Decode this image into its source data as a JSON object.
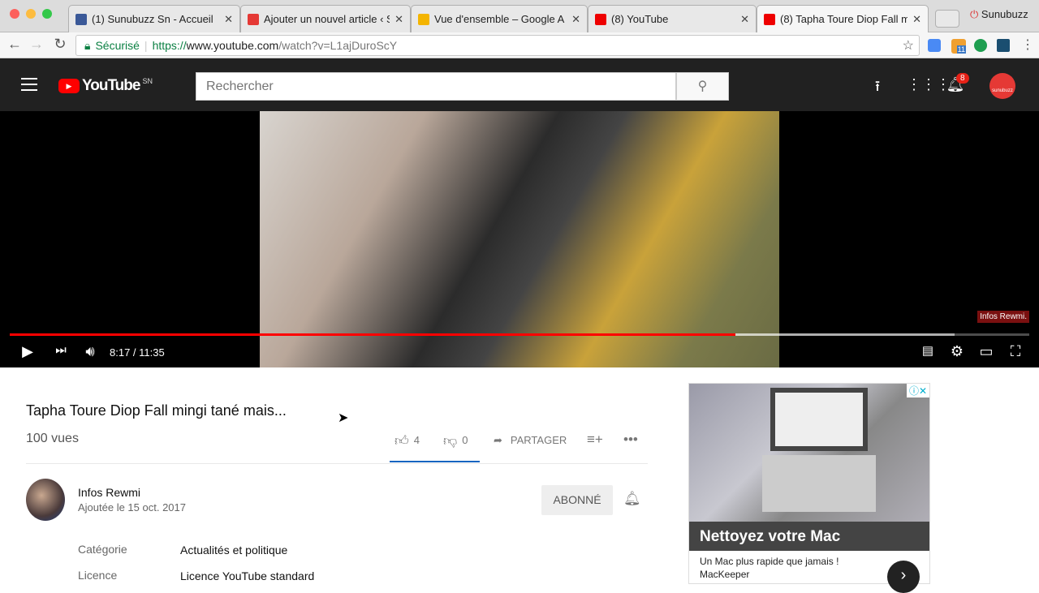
{
  "browser": {
    "tabs": [
      {
        "title": "(1) Sunubuzz Sn - Accueil",
        "favicon": "facebook-icon",
        "color": "#3b5998"
      },
      {
        "title": "Ajouter un nouvel article ‹ S",
        "favicon": "flash-icon",
        "color": "#e53935"
      },
      {
        "title": "Vue d'ensemble – Google A",
        "favicon": "analytics-icon",
        "color": "#f4b400"
      },
      {
        "title": "(8) YouTube",
        "favicon": "youtube-icon",
        "color": "#e00"
      },
      {
        "title": "(8) Tapha Toure Diop Fall mi",
        "favicon": "youtube-icon",
        "color": "#e00"
      }
    ],
    "profile": "Sunubuzz",
    "secure_label": "Sécurisé",
    "url_scheme": "https://",
    "url_host": "www.youtube.com",
    "url_path": "/watch?v=L1ajDuroScY",
    "ext_badge": "11"
  },
  "youtube": {
    "logo": "YouTube",
    "region": "SN",
    "search_placeholder": "Rechercher",
    "notif_count": "8",
    "avatar_text": "sunubuzz"
  },
  "player": {
    "time": "8:17 / 11:35",
    "progress": 0.712,
    "buffered": 0.927,
    "watermark": "Infos Rewmi."
  },
  "video": {
    "title": "Tapha Toure Diop Fall mingi tané mais...",
    "views": "100 vues",
    "likes": "4",
    "dislikes": "0",
    "share": "PARTAGER",
    "channel": "Infos Rewmi",
    "date": "Ajoutée le 15 oct. 2017",
    "subscribe": "ABONNÉ",
    "meta": [
      {
        "label": "Catégorie",
        "value": "Actualités et politique"
      },
      {
        "label": "Licence",
        "value": "Licence YouTube standard"
      }
    ]
  },
  "ad": {
    "headline": "Nettoyez votre Mac",
    "text": "Un Mac plus rapide que jamais !",
    "advertiser": "MacKeeper"
  }
}
